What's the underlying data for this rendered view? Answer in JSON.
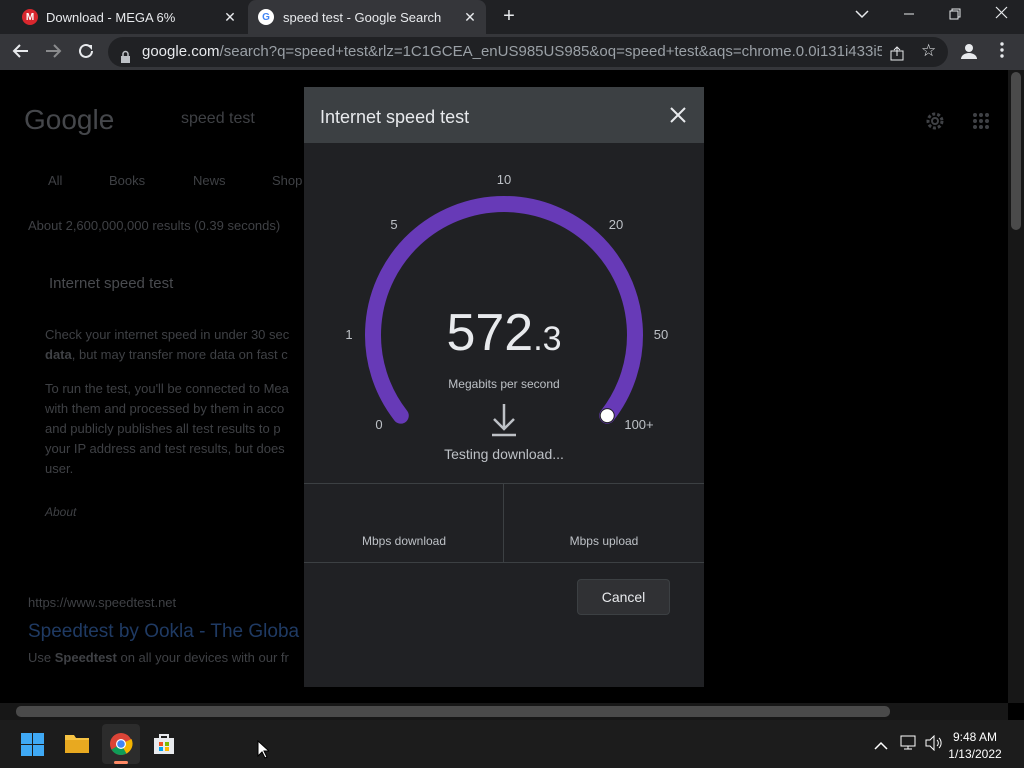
{
  "browser": {
    "tabs": [
      {
        "title": "Download - MEGA 6%",
        "active": false,
        "favicon": "mega-icon"
      },
      {
        "title": "speed test - Google Search",
        "active": true,
        "favicon": "google-icon"
      }
    ],
    "new_tab_glyph": "+",
    "address_domain": "google.com",
    "address_rest": "/search?q=speed+test&rlz=1C1GCEA_enUS985US985&oq=speed+test&aqs=chrome.0.0i131i433i512j0i4..."
  },
  "page": {
    "logo": "Google",
    "search_query": "speed test",
    "tabs": [
      "All",
      "Books",
      "News",
      "Shop"
    ],
    "result_stats": "About 2,600,000,000 results (0.39 seconds)",
    "card_title": "Internet speed test",
    "card_text_1": "Check your internet speed in under 30 sec",
    "card_text_1b": "data",
    "card_text_1c": ", but may transfer more data on fast c",
    "card_text_2": "To run the test, you'll be connected to Mea",
    "card_text_2b": "with them and processed by them in acco",
    "card_text_2c": "and publicly publishes all test results to p",
    "card_text_2d": "your IP address and test results, but does",
    "card_text_2e": "user.",
    "about": "About",
    "result_url": "https://www.speedtest.net",
    "result_title": "Speedtest by Ookla - The Globa",
    "result_snippet_pre": "Use ",
    "result_snippet_bold": "Speedtest",
    "result_snippet_post": " on all your devices with our fr"
  },
  "modal": {
    "title": "Internet speed test",
    "gauge_ticks": [
      "0",
      "1",
      "5",
      "10",
      "20",
      "50",
      "100+"
    ],
    "speed_whole": "572",
    "speed_decimal": ".3",
    "units": "Megabits per second",
    "status": "Testing download...",
    "download_label": "Mbps download",
    "upload_label": "Mbps upload",
    "cancel_label": "Cancel",
    "gauge_progress": 1.0,
    "accent_color": "#673ab7"
  },
  "taskbar": {
    "time": "9:48 AM",
    "date": "1/13/2022"
  }
}
